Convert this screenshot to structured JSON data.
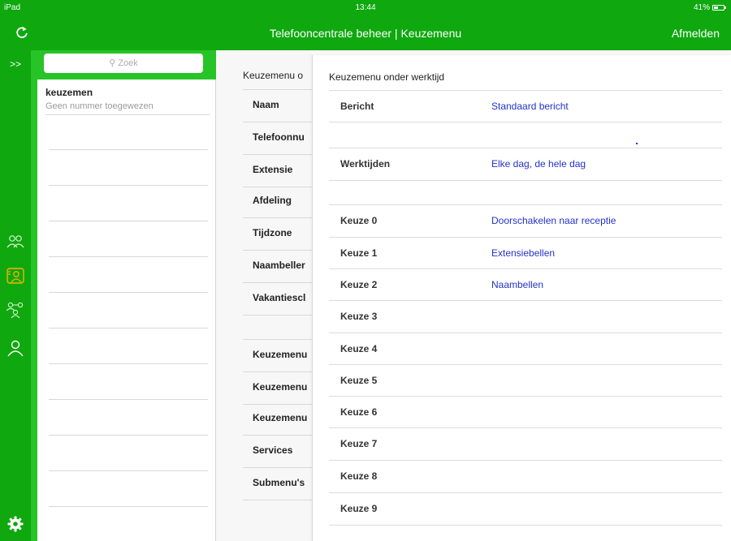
{
  "statusbar": {
    "device": "iPad",
    "time": "13:44",
    "battery": "41%"
  },
  "navbar": {
    "title": "Telefooncentrale beheer | Keuzemenu",
    "logout": "Afmelden"
  },
  "rail": {
    "expand": ">>",
    "icons": [
      "users-group-icon",
      "phone-contact-icon",
      "org-chart-icon",
      "single-user-icon",
      "gear-icon"
    ],
    "accent": "#f2b400"
  },
  "list": {
    "search_placeholder": "Zoek",
    "items": [
      {
        "title": "keuzemen",
        "subtitle": "Geen nummer toegewezen"
      }
    ]
  },
  "detail": {
    "header": "Keuzemenu o",
    "rows": [
      "Naam",
      "Telefoonnu",
      "Extensie",
      "Afdeling",
      "Tijdzone",
      "Naambeller",
      "Vakantiescl",
      "Keuzemenu",
      "Keuzemenu",
      "Keuzemenu",
      "Services",
      "Submenu's"
    ]
  },
  "panel": {
    "title": "Keuzemenu onder werktijd",
    "rows": [
      {
        "key": "Bericht",
        "value": "Standaard bericht"
      },
      {
        "key": "Werktijden",
        "value": "Elke dag, de hele dag"
      },
      {
        "key": "Keuze 0",
        "value": "Doorschakelen naar receptie"
      },
      {
        "key": "Keuze 1",
        "value": "Extensiebellen"
      },
      {
        "key": "Keuze 2",
        "value": "Naambellen"
      },
      {
        "key": "Keuze 3",
        "value": ""
      },
      {
        "key": "Keuze 4",
        "value": ""
      },
      {
        "key": "Keuze 5",
        "value": ""
      },
      {
        "key": "Keuze 6",
        "value": ""
      },
      {
        "key": "Keuze 7",
        "value": ""
      },
      {
        "key": "Keuze 8",
        "value": ""
      },
      {
        "key": "Keuze 9",
        "value": ""
      }
    ]
  },
  "colors": {
    "green": "#0fa80f",
    "green_light": "#26c426",
    "link": "#2432c8"
  }
}
